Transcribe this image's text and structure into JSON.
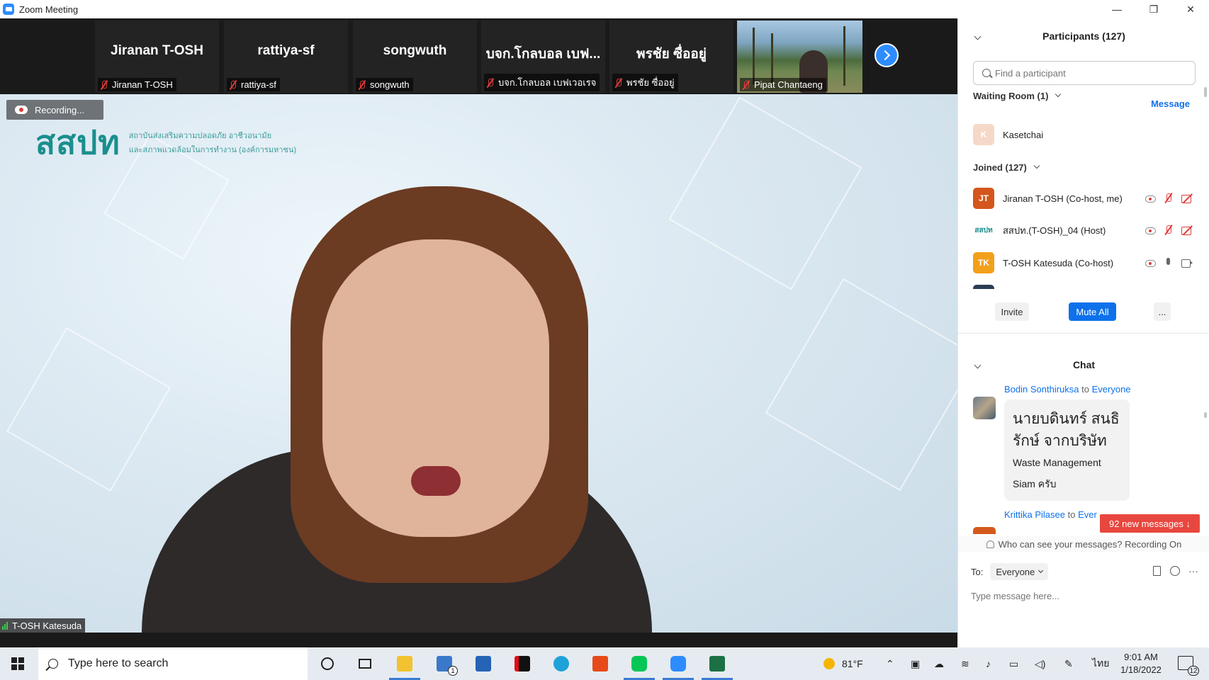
{
  "window": {
    "title": "Zoom Meeting",
    "controls": [
      "—",
      "❐",
      "✕"
    ]
  },
  "gallery_strip": {
    "tiles": [
      {
        "name": "Jiranan T-OSH",
        "label": "Jiranan T-OSH"
      },
      {
        "name": "rattiya-sf",
        "label": "rattiya-sf"
      },
      {
        "name": "songwuth",
        "label": "songwuth"
      },
      {
        "name": "บจก.โกลบอล เบฟ...",
        "label": "บจก.โกลบอล เบฟเวอเรจ"
      },
      {
        "name": "พรชัย ซื่ออยู่",
        "label": "พรชัย ซื่ออยู่"
      },
      {
        "name": "",
        "label": "Pipat Chantaeng"
      }
    ]
  },
  "main_video": {
    "recording_label": "Recording...",
    "logo_mark": "สสปท",
    "logo_line1": "สถาบันส่งเสริมความปลอดภัย อาชีวอนามัย",
    "logo_line2": "และสภาพแวดล้อมในการทำงาน (องค์การมหาชน)",
    "speaker_name": "T-OSH Katesuda"
  },
  "participants_panel": {
    "title": "Participants (127)",
    "search_placeholder": "Find a participant",
    "waiting_room_label": "Waiting Room (1)",
    "message_link": "Message",
    "waiting": [
      {
        "initial": "K",
        "name": "Kasetchai",
        "color": "#f6d8c8"
      }
    ],
    "joined_label": "Joined (127)",
    "joined": [
      {
        "initials": "JT",
        "name": "Jiranan T-OSH (Co-host, me)",
        "color": "#d4561d",
        "mic": "off",
        "cam": "off"
      },
      {
        "initials": "สสปท",
        "name": "สสปท.(T-OSH)_04 (Host)",
        "color": "#ffffff",
        "mic": "off",
        "cam": "off"
      },
      {
        "initials": "TK",
        "name": "T-OSH Katesuda (Co-host)",
        "color": "#f2a01a",
        "mic": "on",
        "cam": "on"
      }
    ],
    "invite_label": "Invite",
    "mute_all_label": "Mute All",
    "more_label": "..."
  },
  "chat_panel": {
    "title": "Chat",
    "messages": [
      {
        "sender": "Bodin Sonthiruksa",
        "to_word": "to",
        "recipient": "Everyone",
        "text_line1": "นายบดินทร์ สนธิ",
        "text_line2": "รักษ์ จากบริษัท",
        "text_line3": "Waste Management",
        "text_line4": "Siam ครับ"
      },
      {
        "sender": "Krittika Pilasee",
        "to_word": "to",
        "recipient": "Ever"
      }
    ],
    "new_messages_label": "92 new messages ↓",
    "visibility_notice": "Who can see your messages? Recording On",
    "to_label": "To:",
    "to_value": "Everyone",
    "input_placeholder": "Type message here...",
    "more_tools": "···"
  },
  "taskbar": {
    "search_placeholder": "Type here to search",
    "mail_badge": "1",
    "weather": "81°F",
    "language": "ไทย",
    "time": "9:01 AM",
    "date": "1/18/2022",
    "notification_count": "12"
  }
}
